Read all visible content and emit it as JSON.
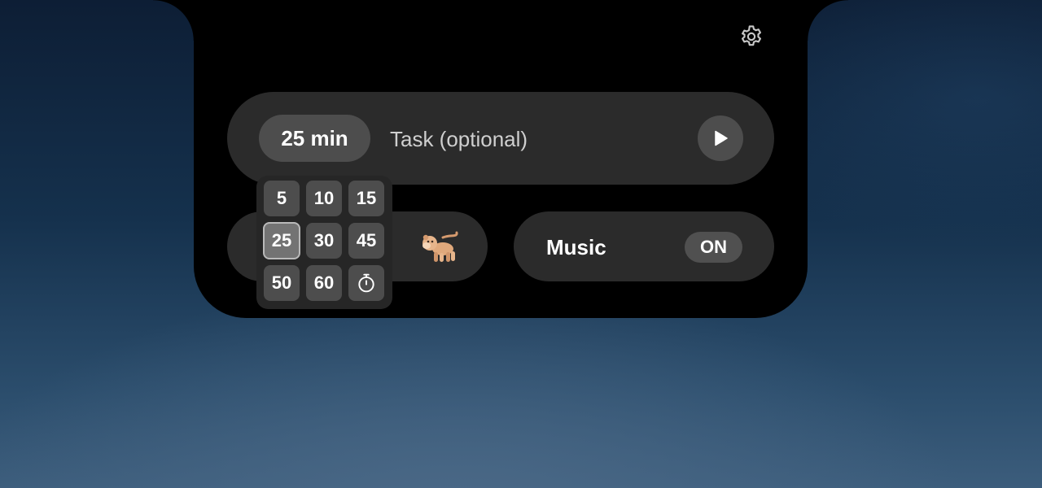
{
  "settings": {
    "icon": "gear-icon"
  },
  "task_bar": {
    "duration_label": "25 min",
    "task_placeholder": "Task (optional)",
    "task_value": "",
    "play_icon": "play-icon"
  },
  "duration_picker": {
    "selected": "25",
    "options": [
      "5",
      "10",
      "15",
      "25",
      "30",
      "45",
      "50",
      "60"
    ],
    "custom_icon": "stopwatch-icon"
  },
  "pet": {
    "icon": "monkey-icon"
  },
  "music": {
    "label": "Music",
    "toggle_label": "ON",
    "enabled": true
  },
  "colors": {
    "panel": "#000000",
    "pill": "#2b2b2b",
    "button": "#4d4d4d",
    "button_selected": "#737373",
    "text": "#ffffff"
  }
}
